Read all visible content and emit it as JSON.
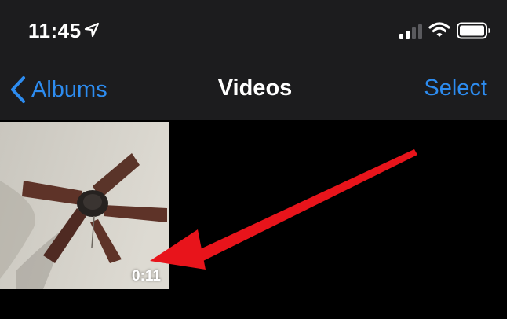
{
  "status_bar": {
    "time": "11:45",
    "icons": [
      "location-arrow-icon",
      "cellular-signal-icon",
      "wifi-icon",
      "battery-icon"
    ]
  },
  "nav_bar": {
    "back_label": "Albums",
    "title": "Videos",
    "select_label": "Select"
  },
  "videos": [
    {
      "duration": "0:11",
      "thumbnail": "ceiling-fan"
    }
  ],
  "colors": {
    "accent": "#2d8cf0",
    "bar_background": "#1c1c1e",
    "background": "#000000",
    "annotation_arrow": "#e8141b"
  }
}
